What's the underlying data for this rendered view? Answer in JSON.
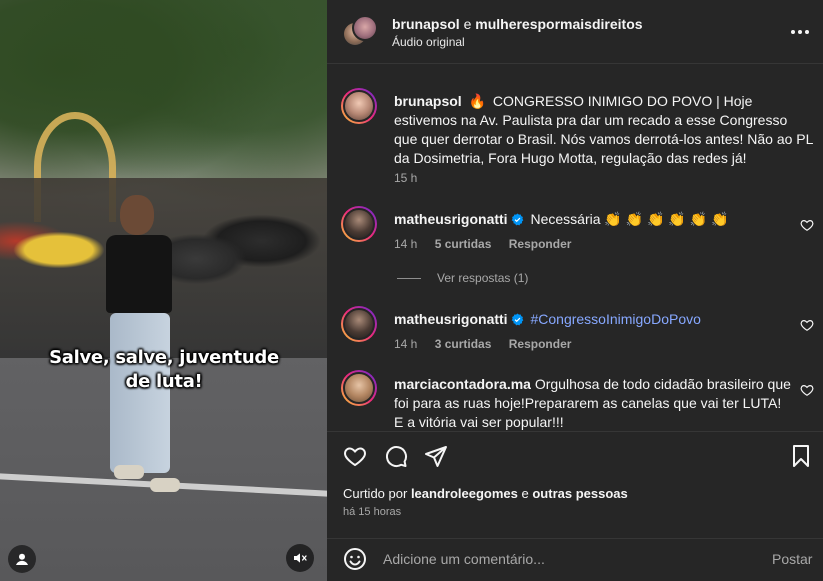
{
  "media": {
    "caption": "Salve, salve, juventude de luta!",
    "user_icon": "user-circle-icon",
    "mute_icon": "speaker-muted-icon"
  },
  "header": {
    "user1": "brunapsol",
    "joiner": "e",
    "user2": "mulherespormaisdireitos",
    "audio": "Áudio original",
    "more_icon": "more-horizontal-icon"
  },
  "post": {
    "username": "brunapsol",
    "emoji": "🔥",
    "text": "CONGRESSO INIMIGO DO POVO | Hoje estivemos na Av. Paulista pra dar um recado a esse Congresso que quer derrotar o Brasil. Nós vamos derrotá-los antes! Não ao PL da Dosimetria, Fora Hugo Motta, regulação das redes já!",
    "time": "15 h"
  },
  "comments": [
    {
      "username": "matheusrigonatti",
      "verified": true,
      "text": "Necessária 👏 👏 👏 👏 👏 👏",
      "time": "14 h",
      "likes": "5 curtidas",
      "reply": "Responder",
      "view_replies": "Ver respostas (1)"
    },
    {
      "username": "matheusrigonatti",
      "verified": true,
      "text": "#CongressoInimigoDoPovo",
      "time": "14 h",
      "likes": "3 curtidas",
      "reply": "Responder"
    },
    {
      "username": "marciacontadora.ma",
      "verified": false,
      "text": "Orgulhosa de todo cidadão brasileiro que foi para as ruas hoje!Prepararem as canelas que vai ter LUTA! E a vitória vai ser popular!!!"
    }
  ],
  "actions": {
    "liked_by_prefix": "Curtido por",
    "liked_by_user": "leandroleegomes",
    "liked_by_and": "e",
    "liked_by_others": "outras pessoas",
    "time_ago": "há 15 horas"
  },
  "comment_box": {
    "placeholder": "Adicione um comentário...",
    "post_label": "Postar"
  },
  "colors": {
    "panel_bg": "#262626",
    "hashtag": "#87a8ff",
    "verified": "#0095f6",
    "muted_text": "#a8a8a8"
  }
}
